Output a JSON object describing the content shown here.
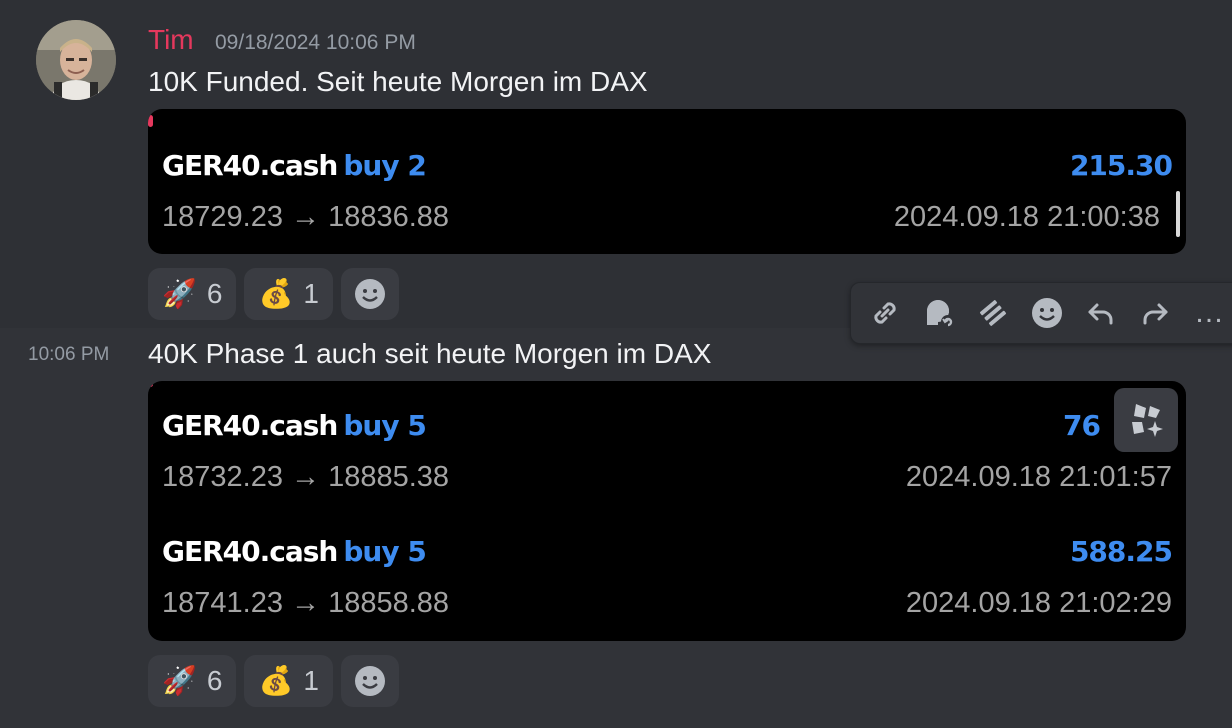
{
  "message1": {
    "author": "Tim",
    "timestamp": "09/18/2024 10:06 PM",
    "text": "10K Funded. Seit heute Morgen im DAX",
    "trades": [
      {
        "symbol": "GER40.cash",
        "side": "buy 2",
        "profit": "215.30",
        "price_range": "18729.23 → 18836.88",
        "datetime": "2024.09.18 21:00:38"
      }
    ],
    "reactions": [
      {
        "emoji": "🚀",
        "count": "6"
      },
      {
        "emoji": "💰",
        "count": "1"
      }
    ]
  },
  "message2": {
    "timestamp": "10:06 PM",
    "text": "40K Phase 1 auch seit heute Morgen im DAX",
    "trades": [
      {
        "symbol": "GER40.cash",
        "side": "buy 5",
        "profit": "76",
        "price_range": "18732.23 → 18885.38",
        "datetime": "2024.09.18 21:01:57"
      },
      {
        "symbol": "GER40.cash",
        "side": "buy 5",
        "profit": "588.25",
        "price_range": "18741.23 → 18858.88",
        "datetime": "2024.09.18 21:02:29"
      }
    ],
    "reactions": [
      {
        "emoji": "🚀",
        "count": "6"
      },
      {
        "emoji": "💰",
        "count": "1"
      }
    ]
  },
  "toolbar": {
    "icons": [
      "link-icon",
      "thread-icon",
      "forward-icon",
      "emoji-icon",
      "reply-icon",
      "share-icon",
      "more-icon"
    ],
    "more_label": "…"
  },
  "colors": {
    "author": "#e5385d",
    "profit": "#3e8cf0",
    "background": "#313338"
  }
}
